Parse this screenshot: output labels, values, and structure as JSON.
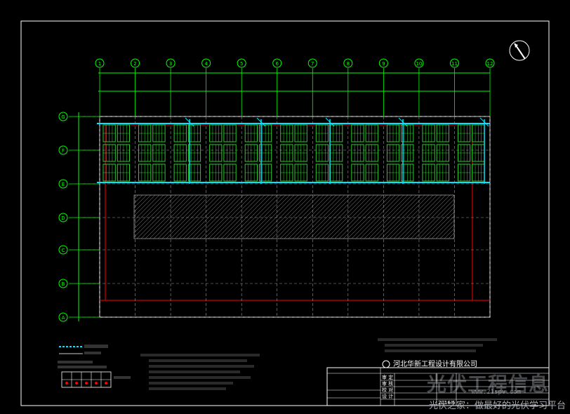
{
  "axes": {
    "top": [
      "1",
      "2",
      "3",
      "4",
      "5",
      "6",
      "7",
      "8",
      "9",
      "10",
      "11",
      "12"
    ],
    "left": [
      "G",
      "F",
      "E",
      "D",
      "C",
      "B",
      "A"
    ]
  },
  "colors": {
    "background": "#000000",
    "frame": "#ffffff",
    "axis_line": "#00ff00",
    "panel": "#33dd33",
    "conduit": "#00e5ff",
    "column": "#ff0000",
    "hatch": "#9a9a9a",
    "grid": "#9a9a9a",
    "text": "#ffffff"
  },
  "panel_layout": {
    "bays": 11,
    "panel_rows": 3,
    "panels_per_bay_row": 2
  },
  "title_block": {
    "company": "河北华新工程设计有限公司",
    "date": "2016.5",
    "rows": [
      "审 定",
      "审 核",
      "校 对",
      "设 计"
    ]
  },
  "watermark": {
    "logo": "光伏工程信息",
    "url": "www.21spv.com",
    "slogan": "光伏之家：做最好的光伏学习平台"
  }
}
